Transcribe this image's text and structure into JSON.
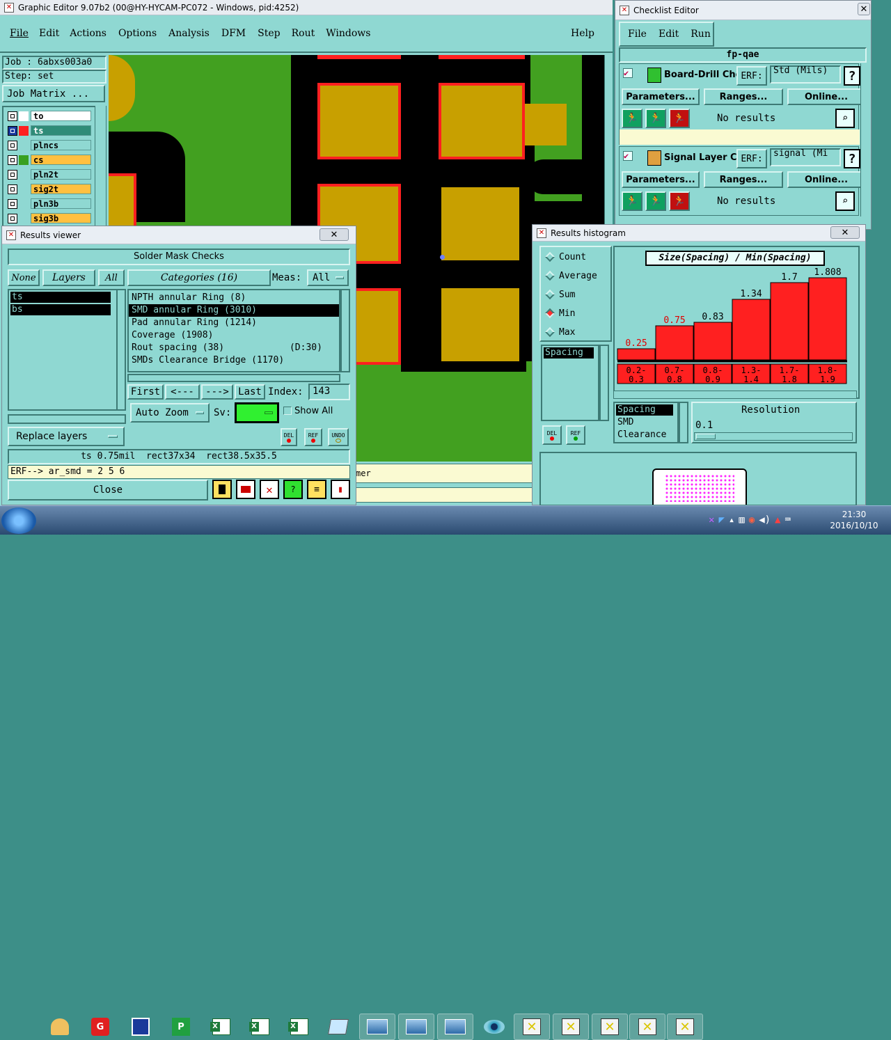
{
  "main": {
    "title": "Graphic Editor 9.07b2 (00@HY-HYCAM-PC072 - Windows, pid:4252)",
    "menu": [
      "File",
      "Edit",
      "Actions",
      "Options",
      "Analysis",
      "DFM",
      "Step",
      "Rout",
      "Windows"
    ],
    "help": "Help",
    "job": "Job : 6abxs003a0",
    "step": "Step: set",
    "job_matrix": "Job Matrix ...",
    "layers": [
      {
        "name": "to",
        "color": "#ffffff",
        "swatch": "#ffffff"
      },
      {
        "name": "ts",
        "color": "#2f8c78",
        "swatch": "#ff2020",
        "active": true
      },
      {
        "name": "plncs",
        "color": "#8fd8d2",
        "swatch": "#8fd8d2"
      },
      {
        "name": "cs",
        "color": "#ffc040",
        "swatch": "#38a020"
      },
      {
        "name": "pln2t",
        "color": "#8fd8d2",
        "swatch": "#8fd8d2"
      },
      {
        "name": "sig2t",
        "color": "#ffc040",
        "swatch": "#8fd8d2"
      },
      {
        "name": "pln3b",
        "color": "#8fd8d2",
        "swatch": "#8fd8d2"
      },
      {
        "name": "sig3b",
        "color": "#ffc040",
        "swatch": "#8fd8d2"
      }
    ],
    "status_fragment": "mer"
  },
  "checklist": {
    "title": "Checklist Editor",
    "menu": [
      "File",
      "Edit",
      "Run"
    ],
    "name": "fp-qae",
    "checks": [
      {
        "label": "Board-Drill Che",
        "erf": "ERF:",
        "erf_value": "Std (Mils)",
        "params": "Parameters...",
        "ranges": "Ranges...",
        "online": "Online...",
        "result": "No results"
      },
      {
        "label": "Signal Layer Ch",
        "erf": "ERF:",
        "erf_value": "signal (Mi",
        "params": "Parameters...",
        "ranges": "Ranges...",
        "online": "Online...",
        "result": "No results"
      }
    ]
  },
  "results_viewer": {
    "title": "Results viewer",
    "header": "Solder Mask Checks",
    "none": "None",
    "layers_label": "Layers",
    "all": "All",
    "categories_label": "Categories (16)",
    "meas_label": "Meas:",
    "meas_value": "All",
    "layer_list": [
      "ts",
      "bs"
    ],
    "categories": [
      "NPTH annular Ring (8)",
      "SMD annular Ring (3010)",
      "Pad annular Ring (1214)",
      "Coverage (1908)",
      "Rout spacing (38)            (D:30)",
      "SMDs Clearance Bridge (1170)"
    ],
    "selected_category": 1,
    "first": "First",
    "prev": "<---",
    "next": "--->",
    "last": "Last",
    "index_label": "Index:",
    "index_value": "143",
    "auto_zoom": "Auto Zoom",
    "sv_label": "Sv:",
    "show_all": "Show All",
    "replace_layers": "Replace layers",
    "del": "DEL",
    "ref": "REF",
    "undo": "UNDO",
    "info": "ts 0.75mil  rect37x34  rect38.5x35.5",
    "erf": "ERF--> ar_smd = 2 5 6",
    "close": "Close"
  },
  "histogram": {
    "title": "Results histogram",
    "modes": [
      "Count",
      "Average",
      "Sum",
      "Min",
      "Max"
    ],
    "selected_mode": "Min",
    "list_item": "Spacing",
    "chart_title": "Size(Spacing) / Min(Spacing)",
    "del": "DEL",
    "ref": "REF",
    "sub_list": [
      "Spacing",
      "SMD",
      "Clearance"
    ],
    "resolution_label": "Resolution",
    "resolution_value": "0.1"
  },
  "chart_data": {
    "type": "bar",
    "title": "Size(Spacing) / Min(Spacing)",
    "categories": [
      "0.2-0.3",
      "0.7-0.8",
      "0.8-0.9",
      "1.3-1.4",
      "1.7-1.8",
      "1.8-1.9"
    ],
    "values": [
      0.25,
      0.75,
      0.83,
      1.34,
      1.7,
      1.808
    ],
    "value_labels": [
      "0.25",
      "0.75",
      "0.83",
      "1.34",
      "1.7",
      "1.808"
    ],
    "label_colors": [
      "#e00000",
      "#e00000",
      "#000000",
      "#000000",
      "#000000",
      "#000000"
    ],
    "ylim": [
      0,
      1.9
    ],
    "bar_color": "#ff2020"
  },
  "taskbar": {
    "time": "21:30",
    "date": "2016/10/10"
  }
}
